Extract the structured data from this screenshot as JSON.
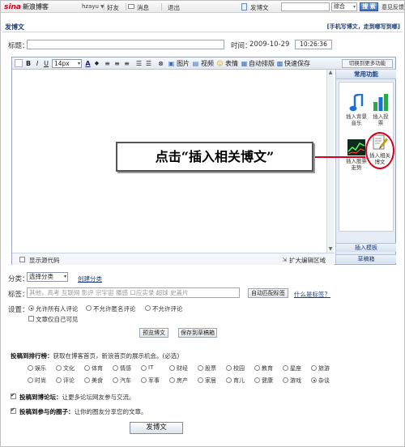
{
  "topbar": {
    "logo_brand": "sina",
    "logo_text": "新浪博客",
    "username": "hzayu",
    "friends": "好友",
    "messages": "消息",
    "logout": "退出",
    "post_blog": "发博文",
    "search_scope": "综合",
    "search_button": "搜 索",
    "feedback": "意见反馈"
  },
  "header": {
    "page_title": "发博文",
    "links": "[手机写博文，走到哪写到哪]"
  },
  "form": {
    "title_label": "标题：",
    "time_label": "时间：",
    "date": "2009-10-29",
    "time": "10:26:36"
  },
  "toolbar": {
    "bold": "B",
    "italic": "I",
    "underline": "U",
    "font_size": "14px",
    "image": "图片",
    "video": "视频",
    "emoticon": "表情",
    "auto_layout": "自动排版",
    "quick_save": "快速保存",
    "switch_to_more": "切换到更多功能"
  },
  "side_panel": {
    "header": "常用功能",
    "tools": [
      {
        "label_line1": "插入背景",
        "label_line2": "音乐",
        "icon": "music-note-icon"
      },
      {
        "label_line1": "插入投",
        "label_line2": "票",
        "icon": "vote-chart-icon"
      },
      {
        "label_line1": "插入股票",
        "label_line2": "走势",
        "icon": "stock-chart-icon"
      },
      {
        "label_line1": "插入相关",
        "label_line2": "博文",
        "icon": "related-post-icon"
      }
    ],
    "tab_templates": "插入模板",
    "tab_drafts": "草稿箱"
  },
  "status_bar": {
    "show_source": "显示源代码",
    "expand_editor": "扩大编辑区域"
  },
  "callout": {
    "text": "点击“插入相关博文”",
    "highlight_color": "#d0021b"
  },
  "category": {
    "label": "分类：",
    "selected": "选择分类",
    "create": "创建分类"
  },
  "tags": {
    "label": "标签：",
    "placeholder": "其他，高考 互联网 影评 宗宇宙 播感 口应实录 超球 史盖片",
    "auto_match": "自动匹配标签",
    "what_is": "什么是标签？"
  },
  "settings": {
    "label": "设置：",
    "comment_options": [
      "允许所有人评论",
      "不允许匿名评论",
      "不允许评论"
    ],
    "private": "文章仅自己可见"
  },
  "actions": {
    "preview": "预览博文",
    "save_draft": "保存到草稿箱",
    "publish": "发博文"
  },
  "ranking": {
    "title": "投稿到排行榜：",
    "description": "获取在博客首页，新浪首页的展示机会。(必选)",
    "categories_row1": [
      "娱乐",
      "文化",
      "体育",
      "情感",
      "IT",
      "财经",
      "股票",
      "校园",
      "教育",
      "星座",
      "旅游"
    ],
    "categories_row2": [
      "时尚",
      "评论",
      "美食",
      "汽车",
      "军事",
      "房产",
      "家居",
      "育儿",
      "健康",
      "游戏",
      "杂谈"
    ],
    "selected": "杂谈"
  },
  "forum": {
    "title": "投稿到博论坛：",
    "description": "让更多论坛网友参与交流。"
  },
  "circle": {
    "title": "投稿到参与的圈子：",
    "description": "让你的圈友分享您的文章。"
  }
}
